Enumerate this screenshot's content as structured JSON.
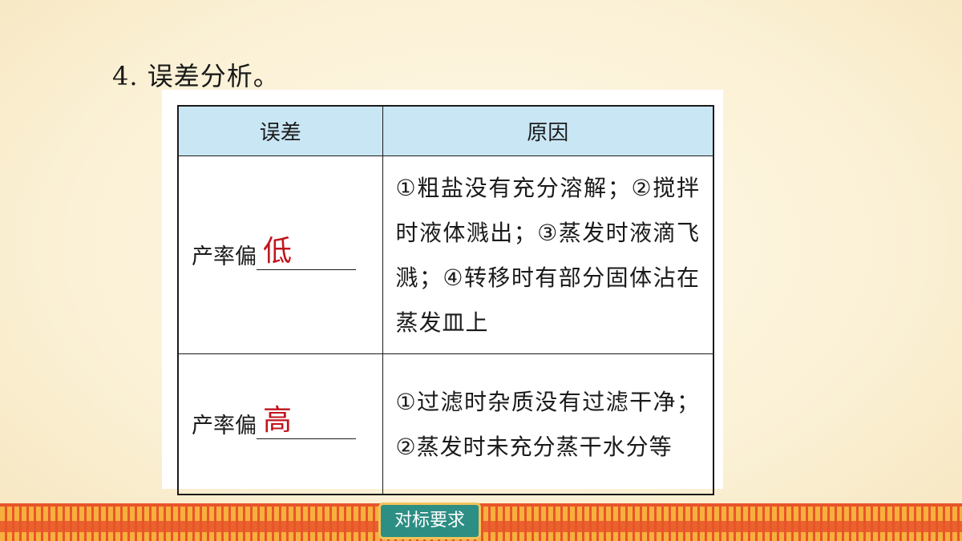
{
  "heading": "4. 误差分析。",
  "table": {
    "headers": [
      "误差",
      "原因"
    ],
    "rows": [
      {
        "label": "产率偏",
        "answer": "低",
        "reason": "①粗盐没有充分溶解；②搅拌时液体溅出；③蒸发时液滴飞溅；④转移时有部分固体沾在蒸发皿上"
      },
      {
        "label": "产率偏",
        "answer": "高",
        "reason": "①过滤时杂质没有过滤干净；②蒸发时未充分蒸干水分等"
      }
    ]
  },
  "footer": {
    "button_label": "对标要求"
  },
  "colors": {
    "header_bg": "#c9e6f5",
    "answer": "#c0141c",
    "button_bg": "#2d8e84",
    "border_orange": "#e8552a"
  }
}
